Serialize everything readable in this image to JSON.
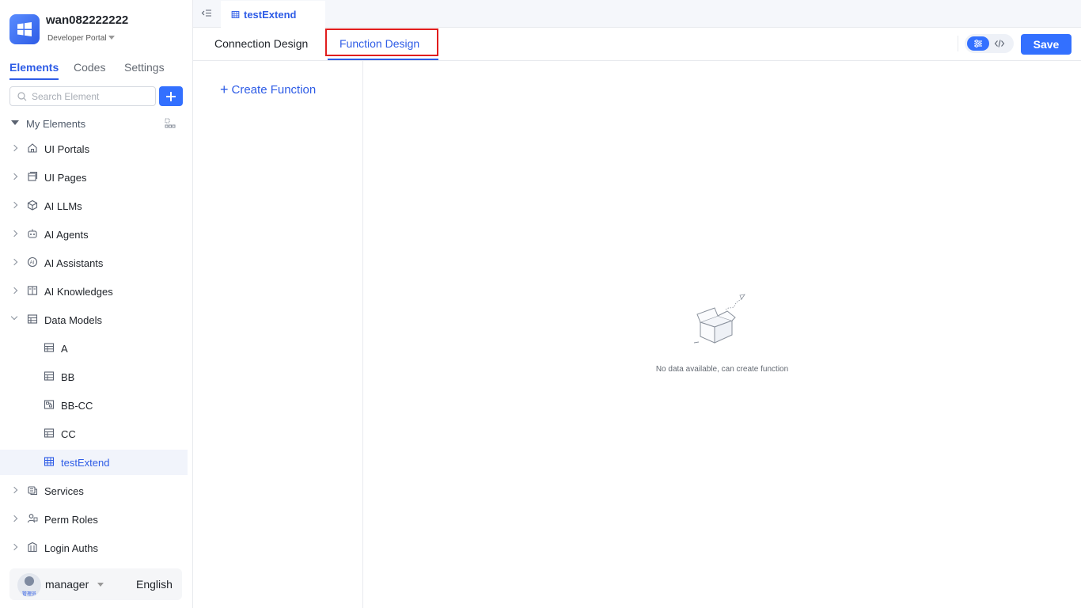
{
  "app": {
    "name": "wan082222222",
    "portal": "Developer Portal"
  },
  "sidebar": {
    "tabs": [
      {
        "label": "Elements"
      },
      {
        "label": "Codes"
      },
      {
        "label": "Settings"
      }
    ],
    "search_placeholder": "Search Element",
    "section_label": "My Elements",
    "items": [
      {
        "label": "UI Portals",
        "icon": "home-icon"
      },
      {
        "label": "UI Pages",
        "icon": "pages-icon"
      },
      {
        "label": "AI LLMs",
        "icon": "cube-icon"
      },
      {
        "label": "AI Agents",
        "icon": "robot-icon"
      },
      {
        "label": "AI Assistants",
        "icon": "ai-assistant-icon"
      },
      {
        "label": "AI Knowledges",
        "icon": "book-icon"
      },
      {
        "label": "Data Models",
        "icon": "table-icon"
      },
      {
        "label": "A",
        "icon": "table-icon"
      },
      {
        "label": "BB",
        "icon": "table-icon"
      },
      {
        "label": "BB-CC",
        "icon": "table-link-icon"
      },
      {
        "label": "CC",
        "icon": "table-icon"
      },
      {
        "label": "testExtend",
        "icon": "table-extend-icon"
      },
      {
        "label": "Services",
        "icon": "service-icon"
      },
      {
        "label": "Perm Roles",
        "icon": "roles-icon"
      },
      {
        "label": "Login Auths",
        "icon": "building-icon"
      }
    ]
  },
  "user": {
    "name": "manager",
    "badge": "管理员",
    "language": "English"
  },
  "document_tab": {
    "label": "testExtend"
  },
  "main": {
    "tabs": [
      {
        "label": "Connection Design"
      },
      {
        "label": "Function Design"
      }
    ],
    "active_tab": "Function Design",
    "save_label": "Save",
    "create_function_label": "Create Function",
    "empty_text": "No data available, can create function"
  },
  "colors": {
    "accent": "#3370ff",
    "active_text": "#2e5ce6",
    "highlight": "#e11d1d"
  }
}
